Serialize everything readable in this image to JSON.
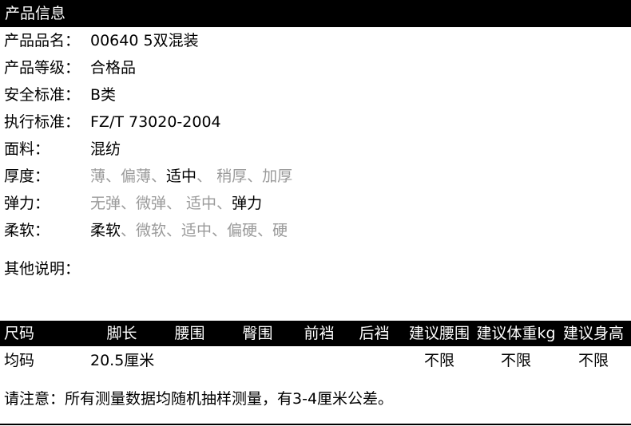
{
  "header": {
    "title": "产品信息"
  },
  "info": [
    {
      "label": "产品品名：",
      "value": "00640 5双混装"
    },
    {
      "label": "产品等级：",
      "value": "合格品"
    },
    {
      "label": "安全标准：",
      "value": "B类"
    },
    {
      "label": "执行标准：",
      "value": "FZ/T 73020-2004"
    },
    {
      "label": "面料：",
      "value": "混纺"
    }
  ],
  "options": {
    "thickness": {
      "label": "厚度：",
      "items": [
        {
          "text": "薄、",
          "selected": false
        },
        {
          "text": "偏薄、",
          "selected": false
        },
        {
          "text": "适中",
          "selected": true
        },
        {
          "text": "、 稍厚、",
          "selected": false
        },
        {
          "text": "加厚",
          "selected": false
        }
      ]
    },
    "elasticity": {
      "label": "弹力：",
      "items": [
        {
          "text": "无弹、",
          "selected": false
        },
        {
          "text": "微弹、 适中、",
          "selected": false
        },
        {
          "text": "弹力",
          "selected": true
        }
      ]
    },
    "softness": {
      "label": "柔软：",
      "items": [
        {
          "text": "柔软",
          "selected": true
        },
        {
          "text": "、微软、适中、偏硬、硬",
          "selected": false
        }
      ]
    }
  },
  "note_label": "其他说明：",
  "size_table": {
    "headers": [
      "尺码",
      "脚长",
      "腰围",
      "臀围",
      "前裆",
      "后裆",
      "建议腰围",
      "建议体重kg",
      "建议身高"
    ],
    "rows": [
      [
        "均码",
        "20.5厘米",
        "",
        "",
        "",
        "",
        "不限",
        "不限",
        "不限"
      ]
    ]
  },
  "footer_note": "请注意：所有测量数据均随机抽样测量，有3-4厘米公差。",
  "colors": {
    "header_bg": "#000000",
    "header_text": "#ffffff",
    "unselected": "#9a9a9a"
  }
}
